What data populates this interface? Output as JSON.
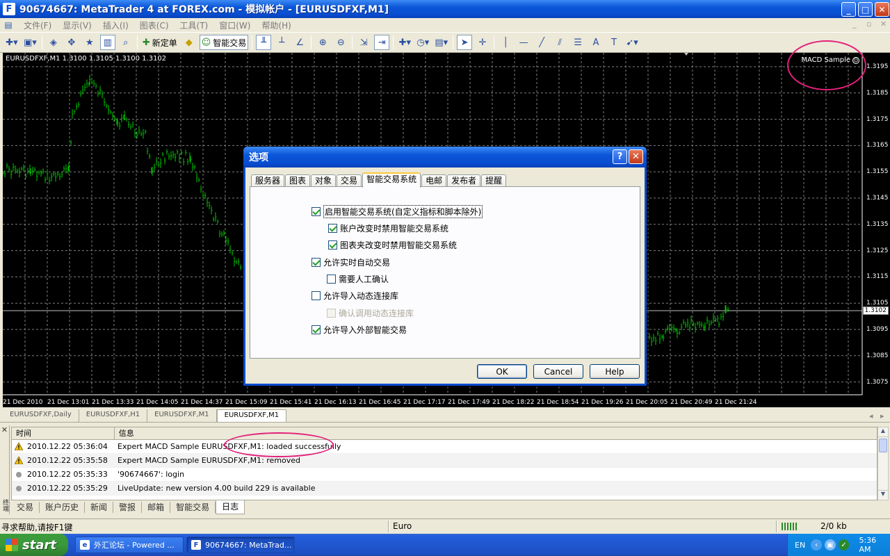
{
  "window": {
    "title": "90674667: MetaTrader 4 at FOREX.com - 模拟帐户 - [EURUSDFXF,M1]",
    "app_icon": "F"
  },
  "menu": {
    "items": [
      "文件(F)",
      "显示(V)",
      "插入(I)",
      "图表(C)",
      "工具(T)",
      "窗口(W)",
      "帮助(H)"
    ]
  },
  "toolbar": {
    "new_order_label": "新定单",
    "expert_label": "智能交易",
    "text_tool": "A",
    "label_tool": "T"
  },
  "chart": {
    "symbol_info": "EURUSDFXF,M1  1.3100 1.3105 1.3100 1.3102",
    "ea_name": "MACD Sample",
    "current_price": "1.3102",
    "y_ticks": [
      "1.3195",
      "1.3185",
      "1.3175",
      "1.3165",
      "1.3155",
      "1.3145",
      "1.3135",
      "1.3125",
      "1.3115",
      "1.3105",
      "1.3095",
      "1.3085",
      "1.3075"
    ],
    "x_ticks": [
      "21 Dec 2010",
      "21 Dec 13:01",
      "21 Dec 13:33",
      "21 Dec 14:05",
      "21 Dec 14:37",
      "21 Dec 15:09",
      "21 Dec 15:41",
      "21 Dec 16:13",
      "21 Dec 16:45",
      "21 Dec 17:17",
      "21 Dec 17:49",
      "21 Dec 18:22",
      "21 Dec 18:54",
      "21 Dec 19:26",
      "21 Dec 20:05",
      "21 Dec 20:49",
      "21 Dec 21:24"
    ],
    "candle_color": "#00C800",
    "grid_color": "#808080"
  },
  "chart_tabs": [
    "EURUSDFXF,Daily",
    "EURUSDFXF,H1",
    "EURUSDFXF,M1",
    "EURUSDFXF,M1"
  ],
  "terminal": {
    "side_label": "终端",
    "columns": [
      "时间",
      "信息"
    ],
    "rows": [
      {
        "icon": "warning",
        "time": "2010.12.22 05:36:04",
        "message": "Expert MACD Sample EURUSDFXF,M1: loaded successfully"
      },
      {
        "icon": "warning",
        "time": "2010.12.22 05:35:58",
        "message": "Expert MACD Sample EURUSDFXF,M1: removed"
      },
      {
        "icon": "dot",
        "time": "2010.12.22 05:35:33",
        "message": "'90674667': login"
      },
      {
        "icon": "dot",
        "time": "2010.12.22 05:35:29",
        "message": "LiveUpdate: new version 4.00 build 229 is available"
      }
    ],
    "tabs": [
      "交易",
      "账户历史",
      "新闻",
      "警报",
      "邮箱",
      "智能交易",
      "日志"
    ]
  },
  "statusbar": {
    "help_text": "寻求帮助,请按F1键",
    "profile": "Euro",
    "traffic": "2/0 kb"
  },
  "taskbar": {
    "start_label": "start",
    "buttons": [
      "外汇论坛 - Powered ...",
      "90674667: MetaTrad..."
    ],
    "tray_lang": "EN",
    "clock": "5:36 AM"
  },
  "dialog": {
    "title": "选项",
    "tabs": [
      "服务器",
      "图表",
      "对象",
      "交易",
      "智能交易系统",
      "电邮",
      "发布者",
      "提醒"
    ],
    "options": [
      {
        "label": "启用智能交易系统(自定义指标和脚本除外)",
        "checked": true,
        "enabled": true
      },
      {
        "label": "账户改变时禁用智能交易系统",
        "checked": true,
        "enabled": true
      },
      {
        "label": "图表夹改变时禁用智能交易系统",
        "checked": true,
        "enabled": true
      },
      {
        "label": "允许实时自动交易",
        "checked": true,
        "enabled": true
      },
      {
        "label": "需要人工确认",
        "checked": false,
        "enabled": true
      },
      {
        "label": "允许导入动态连接库",
        "checked": false,
        "enabled": true
      },
      {
        "label": "确认调用动态连接库",
        "checked": false,
        "enabled": false
      },
      {
        "label": "允许导入外部智能交易",
        "checked": true,
        "enabled": true
      }
    ],
    "buttons": {
      "ok": "OK",
      "cancel": "Cancel",
      "help": "Help"
    }
  }
}
